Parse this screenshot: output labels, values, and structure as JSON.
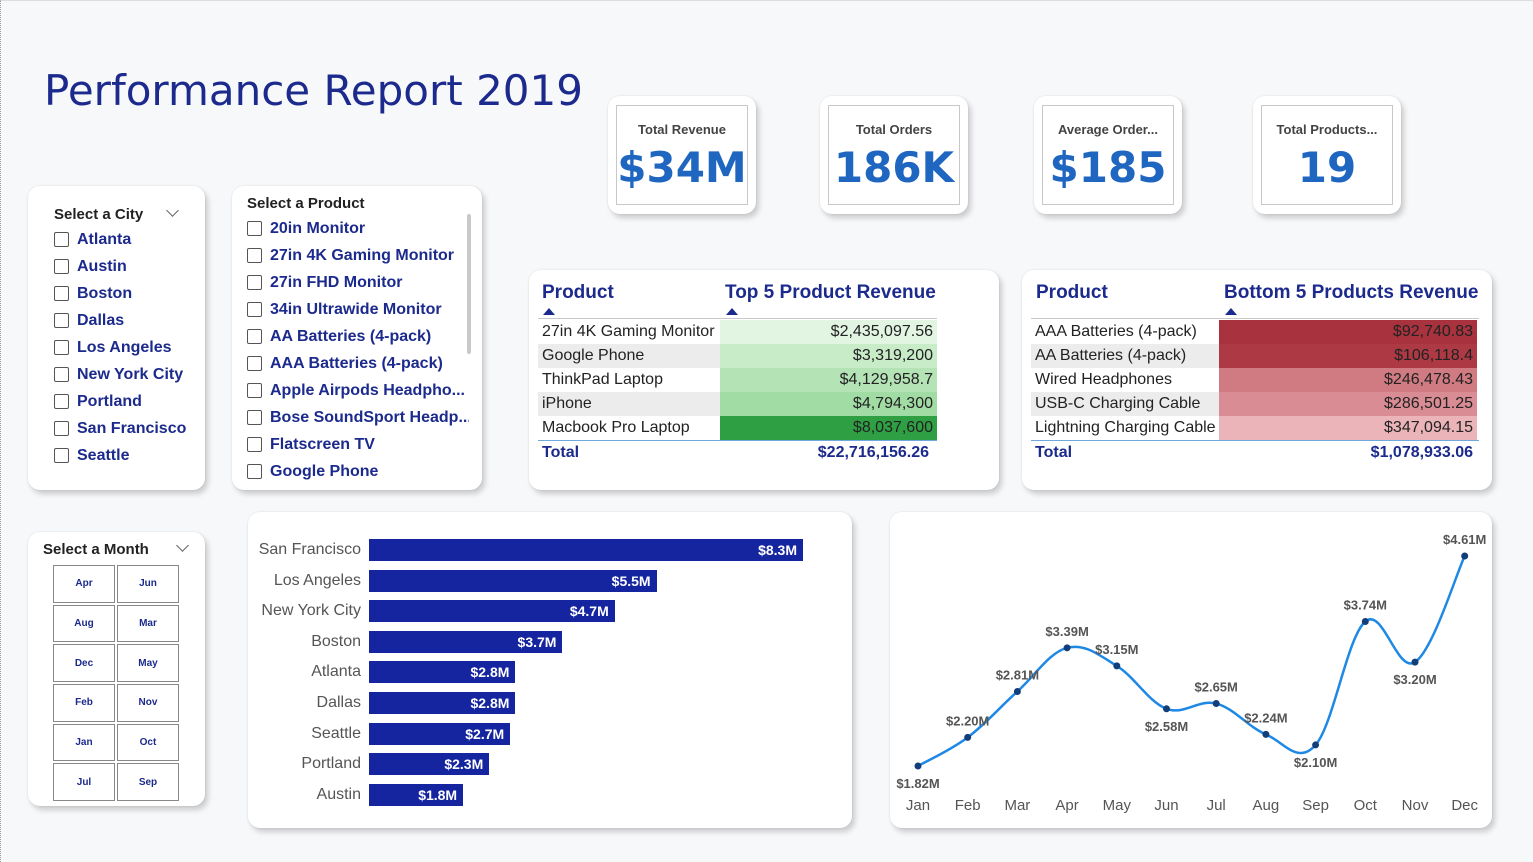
{
  "title": "Performance Report 2019",
  "kpis": [
    {
      "label": "Total Revenue",
      "value": "$34M"
    },
    {
      "label": "Total Orders",
      "value": "186K"
    },
    {
      "label": "Average Order...",
      "value": "$185"
    },
    {
      "label": "Total Products...",
      "value": "19"
    }
  ],
  "city_slicer": {
    "header": "Select a City",
    "options": [
      "Atlanta",
      "Austin",
      "Boston",
      "Dallas",
      "Los Angeles",
      "New York City",
      "Portland",
      "San Francisco",
      "Seattle"
    ]
  },
  "product_slicer": {
    "header": "Select a Product",
    "options": [
      "20in Monitor",
      "27in 4K Gaming Monitor",
      "27in FHD Monitor",
      "34in Ultrawide Monitor",
      "AA Batteries (4-pack)",
      "AAA Batteries (4-pack)",
      "Apple Airpods Headpho...",
      "Bose SoundSport Headp...",
      "Flatscreen TV",
      "Google Phone"
    ]
  },
  "month_slicer": {
    "header": "Select a Month",
    "months": [
      "Apr",
      "Jun",
      "Aug",
      "Mar",
      "Dec",
      "May",
      "Feb",
      "Nov",
      "Jan",
      "Oct",
      "Jul",
      "Sep"
    ]
  },
  "top5_table": {
    "col1": "Product",
    "col2": "Top 5 Product Revenue",
    "rows": [
      {
        "name": "27in 4K Gaming Monitor",
        "value": "$2,435,097.56",
        "color": "#e2f4e2"
      },
      {
        "name": "Google Phone",
        "value": "$3,319,200",
        "color": "#c8ebc8"
      },
      {
        "name": "ThinkPad Laptop",
        "value": "$4,129,958.7",
        "color": "#b4e3b6"
      },
      {
        "name": "iPhone",
        "value": "$4,794,300",
        "color": "#a2dca5"
      },
      {
        "name": "Macbook Pro Laptop",
        "value": "$8,037,600",
        "color": "#2ea043"
      }
    ],
    "total_label": "Total",
    "total_value": "$22,716,156.26"
  },
  "bottom5_table": {
    "col1": "Product",
    "col2": "Bottom 5 Products Revenue",
    "rows": [
      {
        "name": "AAA Batteries (4-pack)",
        "value": "$92,740.83",
        "color": "#a8323d"
      },
      {
        "name": "AA Batteries (4-pack)",
        "value": "$106,118.4",
        "color": "#ac3943"
      },
      {
        "name": "Wired Headphones",
        "value": "$246,478.43",
        "color": "#d07a82"
      },
      {
        "name": "USB-C Charging Cable",
        "value": "$286,501.25",
        "color": "#d98c93"
      },
      {
        "name": "Lightning Charging Cable",
        "value": "$347,094.15",
        "color": "#eab4b8"
      }
    ],
    "total_label": "Total",
    "total_value": "$1,078,933.06"
  },
  "chart_data": [
    {
      "type": "bar",
      "orientation": "horizontal",
      "categories": [
        "San Francisco",
        "Los Angeles",
        "New York City",
        "Boston",
        "Atlanta",
        "Dallas",
        "Seattle",
        "Portland",
        "Austin"
      ],
      "values": [
        8.3,
        5.5,
        4.7,
        3.7,
        2.8,
        2.8,
        2.7,
        2.3,
        1.8
      ],
      "labels": [
        "$8.3M",
        "$5.5M",
        "$4.7M",
        "$3.7M",
        "$2.8M",
        "$2.8M",
        "$2.7M",
        "$2.3M",
        "$1.8M"
      ],
      "color": "#1525a0",
      "title": "",
      "xlabel": "",
      "ylabel": ""
    },
    {
      "type": "line",
      "x": [
        "Jan",
        "Feb",
        "Mar",
        "Apr",
        "May",
        "Jun",
        "Jul",
        "Aug",
        "Sep",
        "Oct",
        "Nov",
        "Dec"
      ],
      "values": [
        1.82,
        2.2,
        2.81,
        3.39,
        3.15,
        2.58,
        2.65,
        2.24,
        2.1,
        3.74,
        3.2,
        4.61
      ],
      "labels": [
        "$1.82M",
        "$2.20M",
        "$2.81M",
        "$3.39M",
        "$3.15M",
        "$2.58M",
        "$2.65M",
        "$2.24M",
        "$2.10M",
        "$3.74M",
        "$3.20M",
        "$4.61M"
      ],
      "label_below": [
        true,
        false,
        false,
        false,
        false,
        true,
        false,
        false,
        true,
        false,
        true,
        false
      ],
      "color": "#1e88e5",
      "title": "",
      "xlabel": "",
      "ylabel": ""
    }
  ]
}
